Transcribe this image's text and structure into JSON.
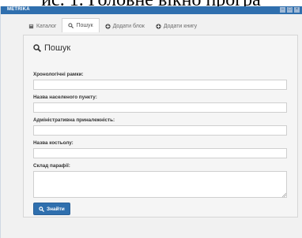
{
  "page_heading": "ис. 1. Головне вікно програ",
  "window": {
    "title": "METRIKA",
    "controls": [
      "minimize",
      "maximize",
      "close"
    ]
  },
  "nav": {
    "tabs": [
      {
        "label": "Каталог",
        "icon": "book-icon",
        "active": false
      },
      {
        "label": "Пошук",
        "icon": "search-icon",
        "active": true
      },
      {
        "label": "Додати блок",
        "icon": "plus-circle-icon",
        "active": false
      },
      {
        "label": "Додати книгу",
        "icon": "plus-circle-icon",
        "active": false
      }
    ]
  },
  "search_form": {
    "title": "Пошук",
    "fields": [
      {
        "label": "Хронологічні рамки:",
        "value": ""
      },
      {
        "label": "Назва населеного пункту:",
        "value": ""
      },
      {
        "label": "Адміністративна приналежність:",
        "value": ""
      },
      {
        "label": "Назва костьолу:",
        "value": ""
      },
      {
        "label": "Склад парафії:",
        "value": ""
      }
    ],
    "submit_label": "Знайти"
  },
  "colors": {
    "titlebar": "#2f6fae",
    "button": "#2f6fae",
    "card_bg": "#f5f5f5"
  }
}
